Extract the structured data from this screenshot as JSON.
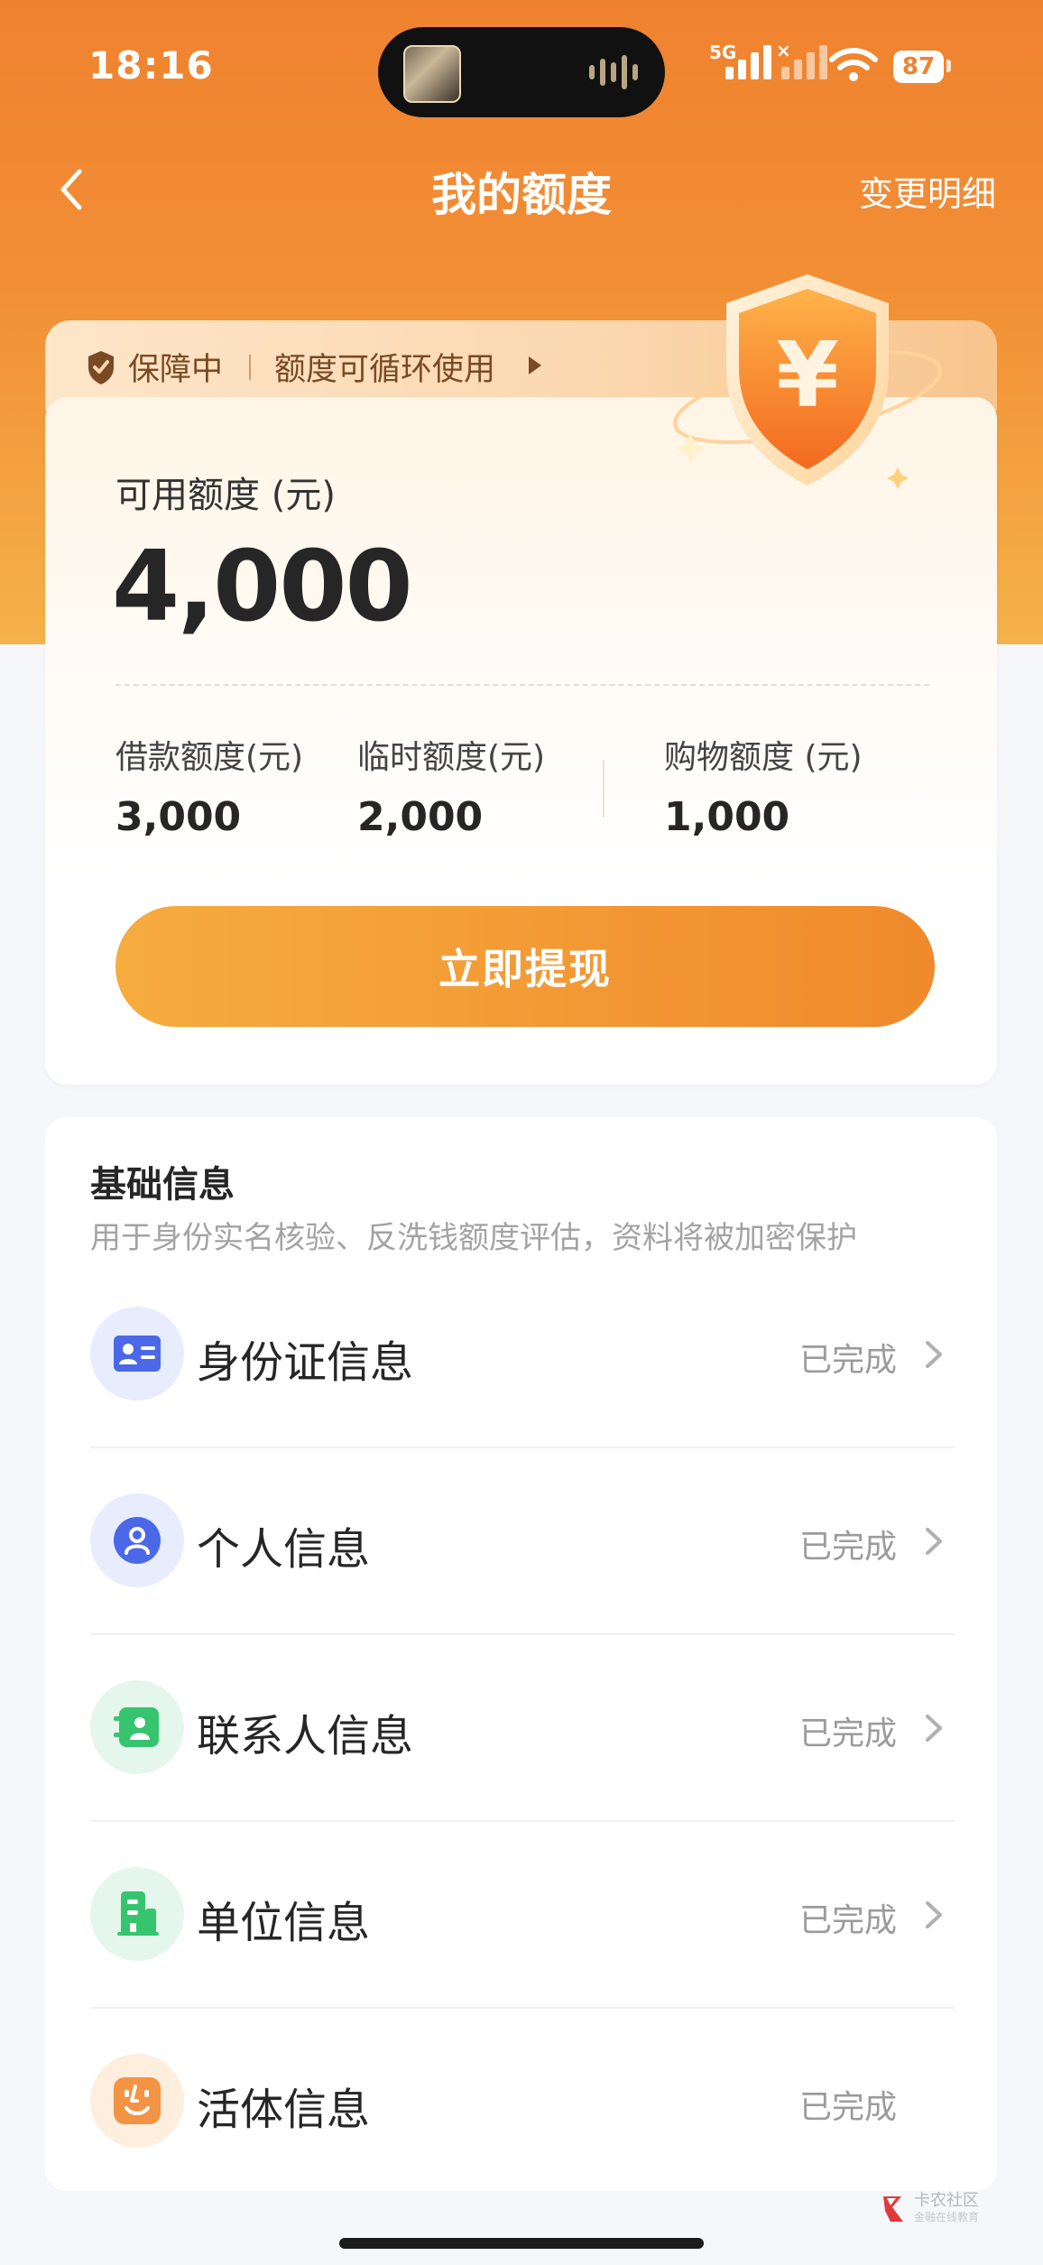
{
  "status_bar": {
    "time": "18:16",
    "network_label": "5G",
    "battery": "87"
  },
  "nav": {
    "title": "我的额度",
    "right_link": "变更明细"
  },
  "guarantee": {
    "status": "保障中",
    "desc": "额度可循环使用"
  },
  "credit": {
    "available_label": "可用额度 (元)",
    "available_value": "4,000",
    "sub_limits": [
      {
        "label": "借款额度(元)",
        "value": "3,000"
      },
      {
        "label": "临时额度(元)",
        "value": "2,000"
      },
      {
        "label": "购物额度 (元)",
        "value": "1,000"
      }
    ],
    "withdraw_button": "立即提现"
  },
  "basic_info": {
    "title": "基础信息",
    "subtitle": "用于身份实名核验、反洗钱额度评估，资料将被加密保护",
    "items": [
      {
        "label": "身份证信息",
        "status": "已完成",
        "icon": "id-card-icon",
        "color": "#4a68e8"
      },
      {
        "label": "个人信息",
        "status": "已完成",
        "icon": "person-icon",
        "color": "#4a68e8"
      },
      {
        "label": "联系人信息",
        "status": "已完成",
        "icon": "contacts-icon",
        "color": "#36c46f"
      },
      {
        "label": "单位信息",
        "status": "已完成",
        "icon": "building-icon",
        "color": "#36c46f"
      },
      {
        "label": "活体信息",
        "status": "已完成",
        "icon": "face-icon",
        "color": "#f29443"
      }
    ]
  },
  "colors": {
    "brand_orange": "#f08a2c",
    "header_gradient_top": "#f0822f",
    "status_gray": "#9b9b9b"
  },
  "watermark": {
    "name": "卡农社区",
    "tagline": "金融在线教育"
  }
}
